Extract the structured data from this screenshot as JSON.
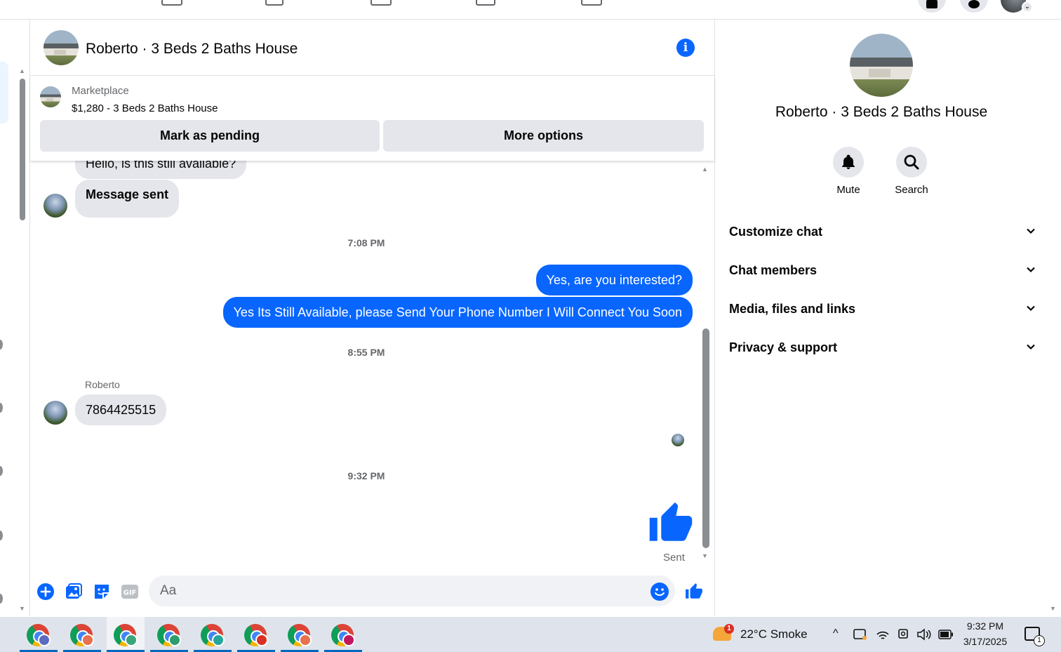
{
  "chat": {
    "title": "Roberto · 3 Beds 2 Baths House",
    "info_icon": "info-icon"
  },
  "marketplace": {
    "label": "Marketplace",
    "listing": "$1,280 - 3 Beds 2 Baths House",
    "mark_pending_label": "Mark as pending",
    "more_options_label": "More options"
  },
  "messages": {
    "partial_incoming": "Hello, is this still available?",
    "incoming_1": "Message sent",
    "time_1": "7:08 PM",
    "outgoing_1": "Yes, are you interested?",
    "outgoing_2": "Yes Its Still Available, please Send Your Phone Number I Will Connect You Soon",
    "time_2": "8:55 PM",
    "sender_name": "Roberto",
    "incoming_2": "7864425515",
    "time_3": "9:32 PM",
    "sent_status": "Sent"
  },
  "composer": {
    "placeholder": "Aa"
  },
  "right_panel": {
    "title": "Roberto · 3 Beds 2 Baths House",
    "mute_label": "Mute",
    "search_label": "Search",
    "sections": [
      "Customize chat",
      "Chat members",
      "Media, files and links",
      "Privacy & support"
    ]
  },
  "taskbar": {
    "weather": "22°C  Smoke",
    "weather_badge": "1",
    "time": "9:32 PM",
    "date": "3/17/2025",
    "notification_count": "1"
  },
  "colors": {
    "accent": "#0866ff",
    "bubble_gray": "#e4e6eb",
    "secondary_text": "#65676b"
  }
}
